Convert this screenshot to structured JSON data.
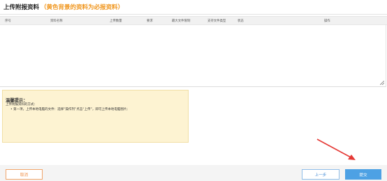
{
  "page": {
    "title": "上传附报资料",
    "title_note": "（黄色背景的资料为必报资料）"
  },
  "table": {
    "columns": [
      "序号",
      "资料名称",
      "上传数量",
      "要求",
      "最大文件限制",
      "支持文件类型",
      "状态",
      "操作"
    ]
  },
  "tips": {
    "title": "温馨提示：",
    "line1": "上传附报资料的方式：",
    "line2": "• 第一项，上传本地电脑的文件：选择“操作列”点击“上传”，即可上传本地电脑图片;"
  },
  "footer": {
    "cancel_label": "取消",
    "prev_label": "上一步",
    "submit_label": "提交"
  },
  "colors": {
    "accent_orange": "#f0961e",
    "submit_blue": "#4da1e4",
    "tips_bg": "#fdf3d2",
    "arrow_red": "#e53935"
  }
}
